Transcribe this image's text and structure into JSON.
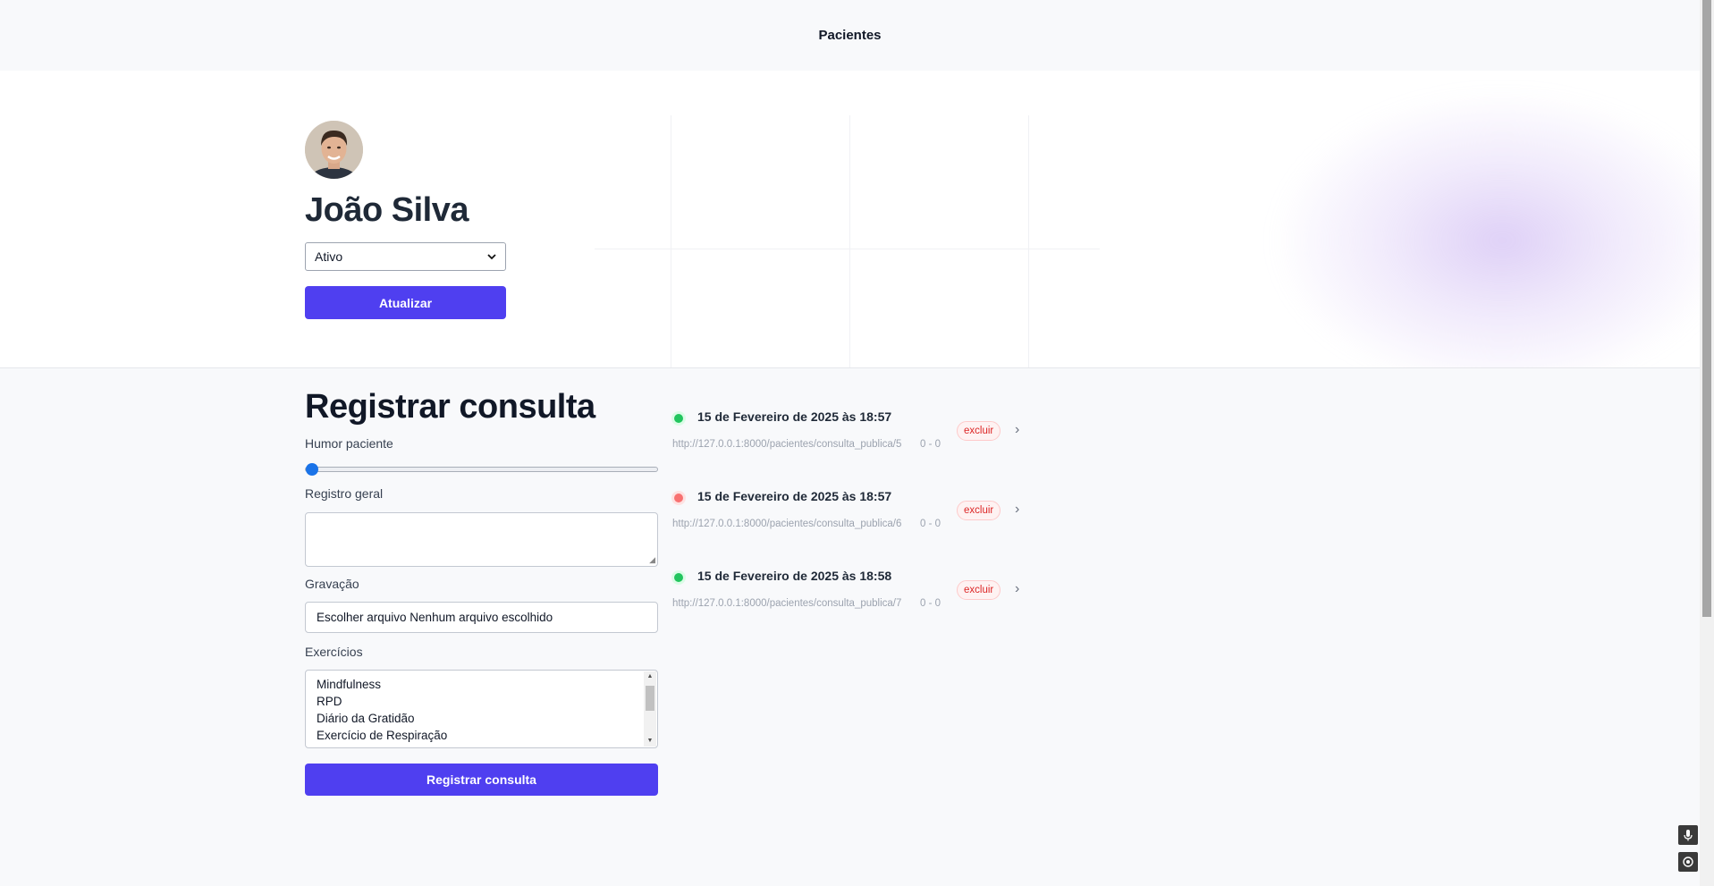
{
  "nav": {
    "patients_link": "Pacientes"
  },
  "patient": {
    "name": "João Silva",
    "status_selected": "Ativo",
    "update_button": "Atualizar"
  },
  "form": {
    "title": "Registrar consulta",
    "mood_label": "Humor paciente",
    "mood_value": 0,
    "general_label": "Registro geral",
    "general_value": "",
    "recording_label": "Gravação",
    "file_input_text": "Escolher arquivo Nenhum arquivo escolhido",
    "exercises_label": "Exercícios",
    "exercises_options": [
      "Mindfulness",
      "RPD",
      "Diário da Gratidão",
      "Exercício de Respiração"
    ],
    "submit_button": "Registrar consulta"
  },
  "consultations": [
    {
      "date": "15 de Fevereiro de 2025 às 18:57",
      "url": "http://127.0.0.1:8000/pacientes/consulta_publica/5",
      "score": "0 - 0",
      "status_color": "#22c55e",
      "delete_label": "excluir"
    },
    {
      "date": "15 de Fevereiro de 2025 às 18:57",
      "url": "http://127.0.0.1:8000/pacientes/consulta_publica/6",
      "score": "0 - 0",
      "status_color": "#f87171",
      "delete_label": "excluir"
    },
    {
      "date": "15 de Fevereiro de 2025 às 18:58",
      "url": "http://127.0.0.1:8000/pacientes/consulta_publica/7",
      "score": "0 - 0",
      "status_color": "#22c55e",
      "delete_label": "excluir"
    }
  ],
  "colors": {
    "primary": "#4f3ff0",
    "danger": "#dc2626"
  },
  "icons": {
    "chevron": "chevron-right-icon",
    "select": "chevron-down-icon",
    "mic": "microphone-icon",
    "target": "crosshair-icon"
  }
}
